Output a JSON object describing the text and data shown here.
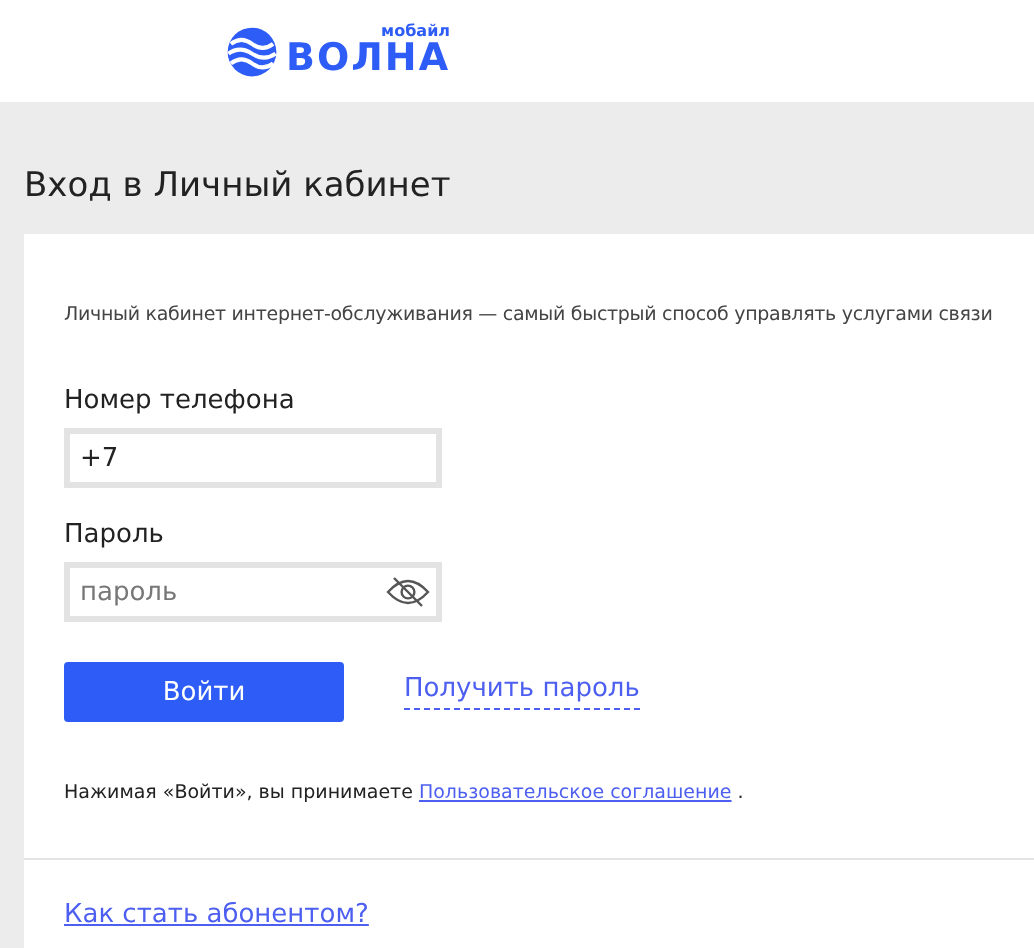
{
  "header": {
    "logo_word": "ВОЛНА",
    "logo_tag": "мобайл"
  },
  "page_title": "Вход в Личный кабинет",
  "intro": "Личный кабинет интернет-обслуживания — самый быстрый способ управлять услугами связи",
  "phone": {
    "label": "Номер телефона",
    "value": "+7"
  },
  "password": {
    "label": "Пароль",
    "placeholder": "пароль",
    "visible": false
  },
  "login_button": "Войти",
  "get_password_link": "Получить пароль",
  "agreement": {
    "prefix": "Нажимая «Войти», вы принимаете",
    "link": "Пользовательское соглашение",
    "suffix": "."
  },
  "subscribe_link": "Как стать абонентом?"
}
